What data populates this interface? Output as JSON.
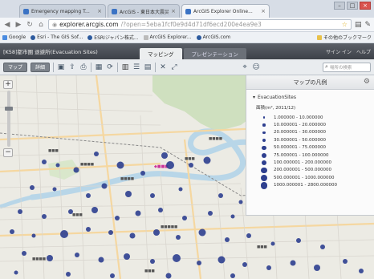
{
  "browser": {
    "tabs": [
      {
        "label": "Emergency mapping T...",
        "favicon_color": "#3b73c4"
      },
      {
        "label": "ArcGIS - 東日本大震災...",
        "favicon_color": "#3b73c4"
      },
      {
        "label": "ArcGIS Explorer Online...",
        "favicon_color": "#3b73c4"
      }
    ],
    "url_scheme": "◉",
    "url_host": "explorer.arcgis.com",
    "url_rest": "/?open=5eba1fcf0e9d4d71df6ecd200e4ea9e3",
    "bookmarks": [
      "Google",
      "Esri - The GIS Sof...",
      "ESRIジャパン株式...",
      "ArcGIS Explorer...",
      "ArcGIS.com"
    ],
    "other_bookmarks": "その他のブックマーク"
  },
  "app": {
    "title": "[K58]都市圏 退避所(Evacuation Sites)",
    "tabs": [
      "マッピング",
      "プレゼンテーション"
    ],
    "signin": "サイン イン",
    "help": "ヘルプ"
  },
  "toolbar": {
    "map_button": "マップ",
    "basemap_button": "詳細",
    "search_placeholder": "場所の検索"
  },
  "legend": {
    "title": "マップの凡例",
    "layer": "EvacuationSites",
    "field": "面積(m², 2011/12)",
    "symbol_color": "#2e3f8f",
    "rows": [
      {
        "label": "1.000000 - 10.000000"
      },
      {
        "label": "10.000001 - 20.000000"
      },
      {
        "label": "20.000001 - 30.000000"
      },
      {
        "label": "30.000001 - 50.000000"
      },
      {
        "label": "50.000001 - 75.000000"
      },
      {
        "label": "75.000001 - 100.000000"
      },
      {
        "label": "100.000001 - 200.000000"
      },
      {
        "label": "200.000001 - 500.000000"
      },
      {
        "label": "500.000001 - 1000.000000"
      },
      {
        "label": "1000.000001 - 2800.000000"
      }
    ]
  },
  "map": {
    "water_color": "#b8d6e8",
    "green_color": "#cfe0bf",
    "site_color": "#2e3f8f"
  }
}
